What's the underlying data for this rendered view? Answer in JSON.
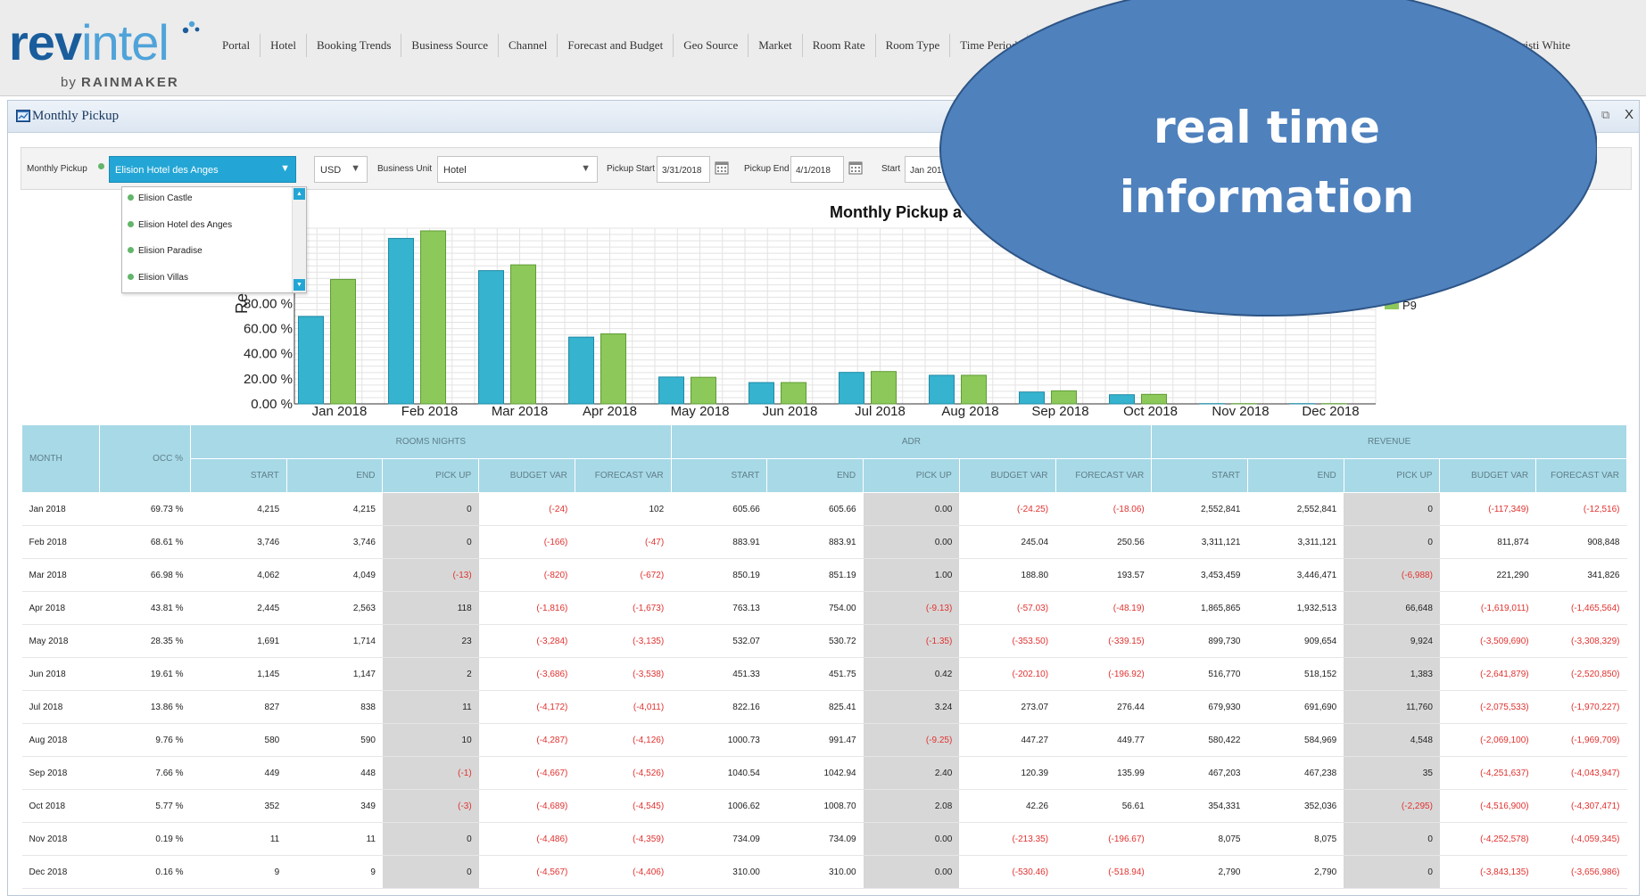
{
  "logo": {
    "word_a": "rev",
    "word_b": "intel",
    "by": "by",
    "company": "RAINMAKER"
  },
  "nav": {
    "items": [
      "Portal",
      "Hotel",
      "Booking Trends",
      "Business Source",
      "Channel",
      "Forecast and Budget",
      "Geo Source",
      "Market",
      "Room Rate",
      "Room Type",
      "Time Period",
      "Adhoc"
    ],
    "user": "Christi White"
  },
  "panel": {
    "title": "Monthly Pickup",
    "restore_icon": "window-restore-icon",
    "close_label": "X"
  },
  "filter": {
    "label": "Monthly Pickup",
    "property": "Elision Hotel des Anges",
    "currency": "USD",
    "business_unit_label": "Business Unit",
    "business_unit": "Hotel",
    "pickup_start_label": "Pickup Start",
    "pickup_start": "3/31/2018",
    "pickup_end_label": "Pickup End",
    "pickup_end": "4/1/2018",
    "start_label": "Start",
    "start": "Jan 201"
  },
  "dropdown": {
    "options": [
      "Elision Castle",
      "Elision Hotel des Anges",
      "Elision Paradise",
      "Elision Villas"
    ]
  },
  "callout": {
    "line1": "real time",
    "line2": "information"
  },
  "colors": {
    "teal_bar": "#35b3cf",
    "green_bar": "#8cc85a",
    "header_blue": "#a8d9e6",
    "callout_blue": "#4f81bd",
    "negative_red": "#e0322f",
    "property_select": "#23a6d5"
  },
  "chart_data": {
    "type": "bar",
    "title": "Monthly Pickup a",
    "ylabel": "Re",
    "categories": [
      "Jan 2018",
      "Feb 2018",
      "Mar 2018",
      "Apr 2018",
      "May 2018",
      "Jun 2018",
      "Jul 2018",
      "Aug 2018",
      "Sep 2018",
      "Oct 2018",
      "Nov 2018",
      "Dec 2018"
    ],
    "y_tick_labels": [
      "0.00 %",
      "20.00 %",
      "40.00 %",
      "60.00 %",
      "80.00 %",
      "100.00 %"
    ],
    "ylim": [
      0,
      140
    ],
    "grid": true,
    "series": [
      {
        "values": [
          69.7,
          131.9,
          106.2,
          53.2,
          21.4,
          17.0,
          25.1,
          22.8,
          9.4,
          7.3,
          0.2,
          0.2
        ]
      },
      {
        "values": [
          99.2,
          137.9,
          110.8,
          55.8,
          21.2,
          17.0,
          25.8,
          22.8,
          10.4,
          7.6,
          0.2,
          0.2
        ]
      }
    ],
    "legend_visible_fragment": "P9",
    "legend_position": "right"
  },
  "table": {
    "groups": {
      "month": "MONTH",
      "occ": "OCC %",
      "rooms": "ROOMS NIGHTS",
      "adr": "ADR",
      "revenue": "REVENUE"
    },
    "subheaders": [
      "START",
      "END",
      "PICK UP",
      "BUDGET VAR",
      "FORECAST VAR"
    ],
    "rows": [
      [
        "Jan 2018",
        "69.73 %",
        "4,215",
        "4,215",
        "0",
        "(-24)",
        "102",
        "605.66",
        "605.66",
        "0.00",
        "(-24.25)",
        "(-18.06)",
        "2,552,841",
        "2,552,841",
        "0",
        "(-117,349)",
        "(-12,516)"
      ],
      [
        "Feb 2018",
        "68.61 %",
        "3,746",
        "3,746",
        "0",
        "(-166)",
        "(-47)",
        "883.91",
        "883.91",
        "0.00",
        "245.04",
        "250.56",
        "3,311,121",
        "3,311,121",
        "0",
        "811,874",
        "908,848"
      ],
      [
        "Mar 2018",
        "66.98 %",
        "4,062",
        "4,049",
        "(-13)",
        "(-820)",
        "(-672)",
        "850.19",
        "851.19",
        "1.00",
        "188.80",
        "193.57",
        "3,453,459",
        "3,446,471",
        "(-6,988)",
        "221,290",
        "341,826"
      ],
      [
        "Apr 2018",
        "43.81 %",
        "2,445",
        "2,563",
        "118",
        "(-1,816)",
        "(-1,673)",
        "763.13",
        "754.00",
        "(-9.13)",
        "(-57.03)",
        "(-48.19)",
        "1,865,865",
        "1,932,513",
        "66,648",
        "(-1,619,011)",
        "(-1,465,564)"
      ],
      [
        "May 2018",
        "28.35 %",
        "1,691",
        "1,714",
        "23",
        "(-3,284)",
        "(-3,135)",
        "532.07",
        "530.72",
        "(-1.35)",
        "(-353.50)",
        "(-339.15)",
        "899,730",
        "909,654",
        "9,924",
        "(-3,509,690)",
        "(-3,308,329)"
      ],
      [
        "Jun 2018",
        "19.61 %",
        "1,145",
        "1,147",
        "2",
        "(-3,686)",
        "(-3,538)",
        "451.33",
        "451.75",
        "0.42",
        "(-202.10)",
        "(-196.92)",
        "516,770",
        "518,152",
        "1,383",
        "(-2,641,879)",
        "(-2,520,850)"
      ],
      [
        "Jul 2018",
        "13.86 %",
        "827",
        "838",
        "11",
        "(-4,172)",
        "(-4,011)",
        "822.16",
        "825.41",
        "3.24",
        "273.07",
        "276.44",
        "679,930",
        "691,690",
        "11,760",
        "(-2,075,533)",
        "(-1,970,227)"
      ],
      [
        "Aug 2018",
        "9.76 %",
        "580",
        "590",
        "10",
        "(-4,287)",
        "(-4,126)",
        "1000.73",
        "991.47",
        "(-9.25)",
        "447.27",
        "449.77",
        "580,422",
        "584,969",
        "4,548",
        "(-2,069,100)",
        "(-1,969,709)"
      ],
      [
        "Sep 2018",
        "7.66 %",
        "449",
        "448",
        "(-1)",
        "(-4,667)",
        "(-4,526)",
        "1040.54",
        "1042.94",
        "2.40",
        "120.39",
        "135.99",
        "467,203",
        "467,238",
        "35",
        "(-4,251,637)",
        "(-4,043,947)"
      ],
      [
        "Oct 2018",
        "5.77 %",
        "352",
        "349",
        "(-3)",
        "(-4,689)",
        "(-4,545)",
        "1006.62",
        "1008.70",
        "2.08",
        "42.26",
        "56.61",
        "354,331",
        "352,036",
        "(-2,295)",
        "(-4,516,900)",
        "(-4,307,471)"
      ],
      [
        "Nov 2018",
        "0.19 %",
        "11",
        "11",
        "0",
        "(-4,486)",
        "(-4,359)",
        "734.09",
        "734.09",
        "0.00",
        "(-213.35)",
        "(-196.67)",
        "8,075",
        "8,075",
        "0",
        "(-4,252,578)",
        "(-4,059,345)"
      ],
      [
        "Dec 2018",
        "0.16 %",
        "9",
        "9",
        "0",
        "(-4,567)",
        "(-4,406)",
        "310.00",
        "310.00",
        "0.00",
        "(-530.46)",
        "(-518.94)",
        "2,790",
        "2,790",
        "0",
        "(-3,843,135)",
        "(-3,656,986)"
      ]
    ]
  }
}
